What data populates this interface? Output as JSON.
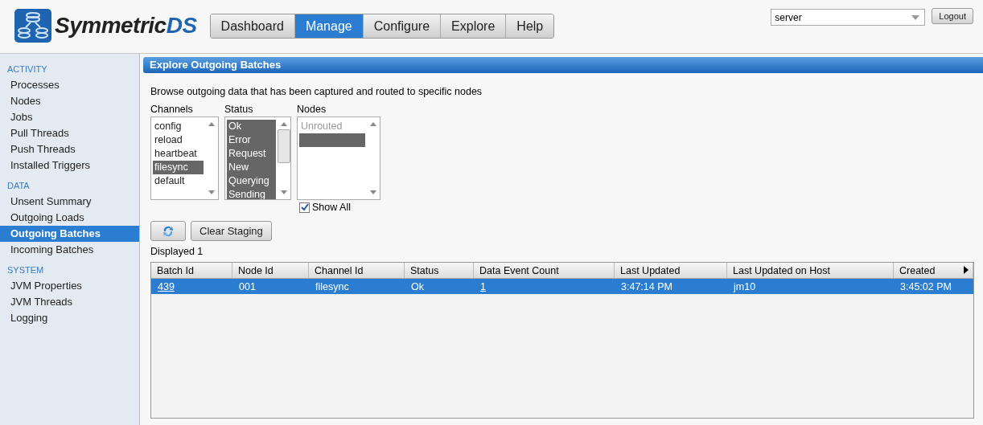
{
  "logo": {
    "name": "Symmetric",
    "suffix": "DS"
  },
  "nav": [
    {
      "label": "Dashboard",
      "selected": false
    },
    {
      "label": "Manage",
      "selected": true
    },
    {
      "label": "Configure",
      "selected": false
    },
    {
      "label": "Explore",
      "selected": false
    },
    {
      "label": "Help",
      "selected": false
    }
  ],
  "server_select": {
    "value": "server"
  },
  "logout": "Logout",
  "sidebar": [
    {
      "heading": "ACTIVITY",
      "items": [
        {
          "label": "Processes",
          "selected": false
        },
        {
          "label": "Nodes",
          "selected": false
        },
        {
          "label": "Jobs",
          "selected": false
        },
        {
          "label": "Pull Threads",
          "selected": false
        },
        {
          "label": "Push Threads",
          "selected": false
        },
        {
          "label": "Installed Triggers",
          "selected": false
        }
      ]
    },
    {
      "heading": "DATA",
      "items": [
        {
          "label": "Unsent Summary",
          "selected": false
        },
        {
          "label": "Outgoing Loads",
          "selected": false
        },
        {
          "label": "Outgoing Batches",
          "selected": true
        },
        {
          "label": "Incoming Batches",
          "selected": false
        }
      ]
    },
    {
      "heading": "SYSTEM",
      "items": [
        {
          "label": "JVM Properties",
          "selected": false
        },
        {
          "label": "JVM Threads",
          "selected": false
        },
        {
          "label": "Logging",
          "selected": false
        }
      ]
    }
  ],
  "panel_title": "Explore Outgoing Batches",
  "description": "Browse outgoing data that has been captured and routed to specific nodes",
  "filters": [
    {
      "label": "Channels",
      "items": [
        {
          "label": "config",
          "selected": false
        },
        {
          "label": "reload",
          "selected": false
        },
        {
          "label": "heartbeat",
          "selected": false
        },
        {
          "label": "filesync",
          "selected": true
        },
        {
          "label": "default",
          "selected": false
        }
      ]
    },
    {
      "label": "Status",
      "scrollable": true,
      "items": [
        {
          "label": "Ok",
          "selected": true
        },
        {
          "label": "Error",
          "selected": true
        },
        {
          "label": "Request",
          "selected": true
        },
        {
          "label": "New",
          "selected": true
        },
        {
          "label": "Querying",
          "selected": true
        },
        {
          "label": "Sending",
          "selected": true
        }
      ]
    },
    {
      "label": "Nodes",
      "items": [
        {
          "label": "Unrouted",
          "selected": false,
          "disabled": true
        },
        {
          "selected": true
        }
      ]
    }
  ],
  "show_all": {
    "label": "Show All",
    "checked": true
  },
  "clear_staging": "Clear Staging",
  "displayed": "Displayed 1",
  "table": {
    "columns": [
      "Batch Id",
      "Node Id",
      "Channel Id",
      "Status",
      "Data Event Count",
      "Last Updated",
      "Last Updated on Host",
      "Created"
    ],
    "rows": [
      {
        "selected": true,
        "cells": [
          {
            "text": "439",
            "kind": "link"
          },
          {
            "text": "001"
          },
          {
            "text": "filesync"
          },
          {
            "text": "Ok"
          },
          {
            "text": "1",
            "kind": "link"
          },
          {
            "text": "3:47:14 PM"
          },
          {
            "text": "jm10"
          },
          {
            "text": "3:45:02 PM"
          }
        ]
      }
    ]
  }
}
